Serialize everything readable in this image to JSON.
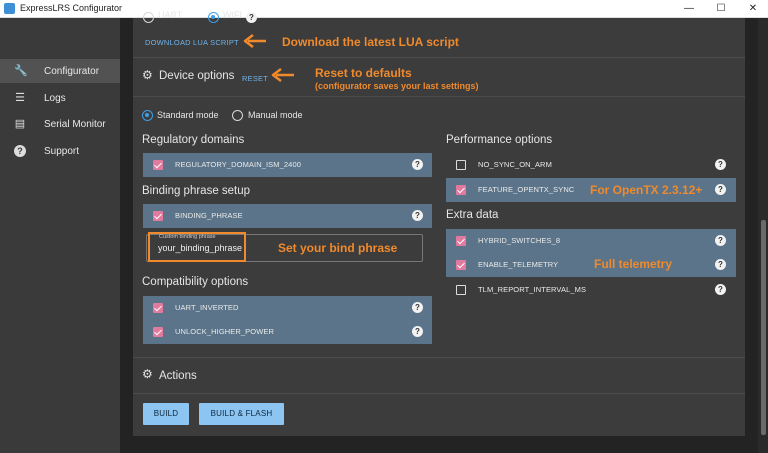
{
  "window": {
    "title": "ExpressLRS Configurator",
    "controls": {
      "minimize": "—",
      "maximize": "☐",
      "close": "✕"
    }
  },
  "sidebar": {
    "items": [
      {
        "label": "Configurator",
        "icon": "wrench-icon",
        "glyph": "🔧",
        "active": true
      },
      {
        "label": "Logs",
        "icon": "list-icon",
        "glyph": "☰",
        "active": false
      },
      {
        "label": "Serial Monitor",
        "icon": "monitor-icon",
        "glyph": "▤",
        "active": false
      },
      {
        "label": "Support",
        "icon": "help-circle-icon",
        "glyph": "?",
        "active": false
      }
    ]
  },
  "flashing_method": {
    "options": [
      {
        "label": "UART",
        "selected": false
      },
      {
        "label": "WIFI",
        "selected": true
      }
    ]
  },
  "lua": {
    "link": "DOWNLOAD LUA SCRIPT"
  },
  "device_options": {
    "title": "Device options",
    "reset_link": "RESET",
    "modes": [
      {
        "label": "Standard mode",
        "selected": true
      },
      {
        "label": "Manual mode",
        "selected": false
      }
    ]
  },
  "regulatory": {
    "title": "Regulatory domains",
    "options": [
      {
        "label": "REGULATORY_DOMAIN_ISM_2400",
        "checked": true
      }
    ]
  },
  "binding": {
    "title": "Binding phrase setup",
    "options": [
      {
        "label": "BINDING_PHRASE",
        "checked": true
      }
    ],
    "input_legend": "Custom binding phrase",
    "input_value": "your_binding_phrase"
  },
  "compatibility": {
    "title": "Compatibility options",
    "options": [
      {
        "label": "UART_INVERTED",
        "checked": true
      },
      {
        "label": "UNLOCK_HIGHER_POWER",
        "checked": true
      }
    ]
  },
  "performance": {
    "title": "Performance options",
    "options": [
      {
        "label": "NO_SYNC_ON_ARM",
        "checked": false
      },
      {
        "label": "FEATURE_OPENTX_SYNC",
        "checked": true
      }
    ]
  },
  "extra": {
    "title": "Extra data",
    "options": [
      {
        "label": "HYBRID_SWITCHES_8",
        "checked": true
      },
      {
        "label": "ENABLE_TELEMETRY",
        "checked": true
      },
      {
        "label": "TLM_REPORT_INTERVAL_MS",
        "checked": false
      }
    ]
  },
  "actions": {
    "title": "Actions",
    "build_label": "BUILD",
    "build_flash_label": "BUILD & FLASH"
  },
  "help_glyph": "?",
  "annotations": {
    "lua": "Download the latest LUA script",
    "reset": "Reset to defaults",
    "reset_sub": "(configurator saves your last settings)",
    "bind": "Set your bind phrase",
    "opentx": "For OpenTX 2.3.12+",
    "telemetry": "Full telemetry"
  },
  "colors": {
    "accent_orange": "#f08a2c",
    "checkbox_pink": "#e27aa0",
    "option_row": "#5b7489",
    "link_blue": "#6fb3ec",
    "button_blue": "#8cc4f2"
  }
}
